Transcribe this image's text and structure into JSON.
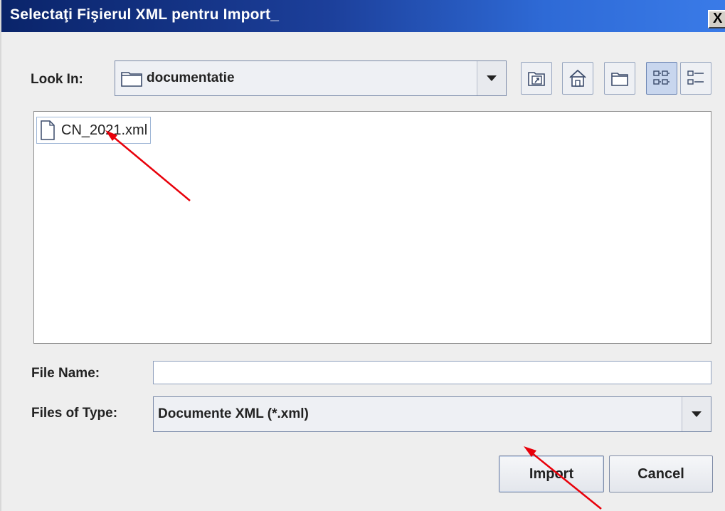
{
  "window": {
    "title": "Selectaţi Fişierul XML pentru Import_",
    "close_glyph": "X"
  },
  "look_in": {
    "label": "Look In:",
    "value": "documentatie",
    "folder_icon": "folder-icon"
  },
  "toolbar": {
    "buttons": [
      {
        "icon": "up-one-level-icon"
      },
      {
        "icon": "home-icon"
      },
      {
        "icon": "new-folder-icon"
      },
      {
        "icon": "list-view-icon",
        "active": true
      },
      {
        "icon": "details-view-icon"
      }
    ]
  },
  "files": {
    "items": [
      {
        "name": "CN_2021.xml",
        "icon": "file-icon",
        "selected": true
      }
    ]
  },
  "file_name": {
    "label": "File Name:",
    "value": "",
    "placeholder": ""
  },
  "files_of_type": {
    "label": "Files of Type:",
    "value": "Documente XML (*.xml)"
  },
  "actions": {
    "import_label": "Import",
    "cancel_label": "Cancel"
  },
  "annotation": {
    "arrow_color": "#e8000a"
  }
}
